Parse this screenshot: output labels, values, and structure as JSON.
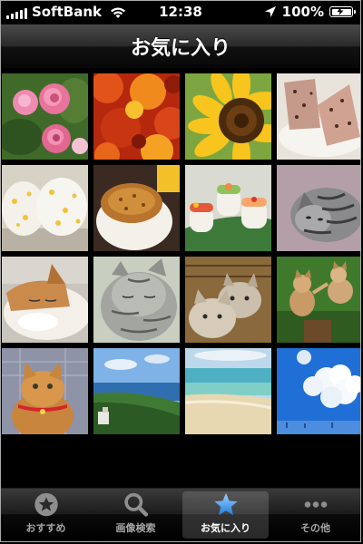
{
  "status_bar": {
    "carrier": "SoftBank",
    "time": "12:38",
    "battery": "100%"
  },
  "nav": {
    "title": "お気に入り"
  },
  "photos": [
    {
      "name": "photo-peonies",
      "subject": "pink peony flowers"
    },
    {
      "name": "photo-autumn-leaves",
      "subject": "red autumn leaves"
    },
    {
      "name": "photo-sunflower",
      "subject": "sunflower"
    },
    {
      "name": "photo-brown-rice-onigiri",
      "subject": "onigiri on plate"
    },
    {
      "name": "photo-corn-onigiri",
      "subject": "corn rice balls"
    },
    {
      "name": "photo-grilled-onigiri",
      "subject": "grilled rice ball"
    },
    {
      "name": "photo-sushi-rolls",
      "subject": "decorated sushi rolls"
    },
    {
      "name": "photo-tabby-cat-lying",
      "subject": "tabby cat lying"
    },
    {
      "name": "photo-sleeping-cat",
      "subject": "sleeping cat"
    },
    {
      "name": "photo-gray-tabby-cat",
      "subject": "gray tabby cat"
    },
    {
      "name": "photo-kittens-basket",
      "subject": "kittens"
    },
    {
      "name": "photo-kittens-playing",
      "subject": "kittens playing"
    },
    {
      "name": "photo-orange-cat-collar",
      "subject": "orange cat with red collar"
    },
    {
      "name": "photo-coastline",
      "subject": "coastline view"
    },
    {
      "name": "photo-beach",
      "subject": "beach and sea"
    },
    {
      "name": "photo-blue-sky-clouds",
      "subject": "blue sky with clouds"
    }
  ],
  "tabs": [
    {
      "label": "おすすめ",
      "icon": "star-badge-icon",
      "active": false
    },
    {
      "label": "画像検索",
      "icon": "search-icon",
      "active": false
    },
    {
      "label": "お気に入り",
      "icon": "star-icon",
      "active": true
    },
    {
      "label": "その他",
      "icon": "more-icon",
      "active": false
    }
  ],
  "colors": {
    "active_tab_icon": "#4aa3f0",
    "inactive_tab_icon": "#8e8e8e"
  }
}
